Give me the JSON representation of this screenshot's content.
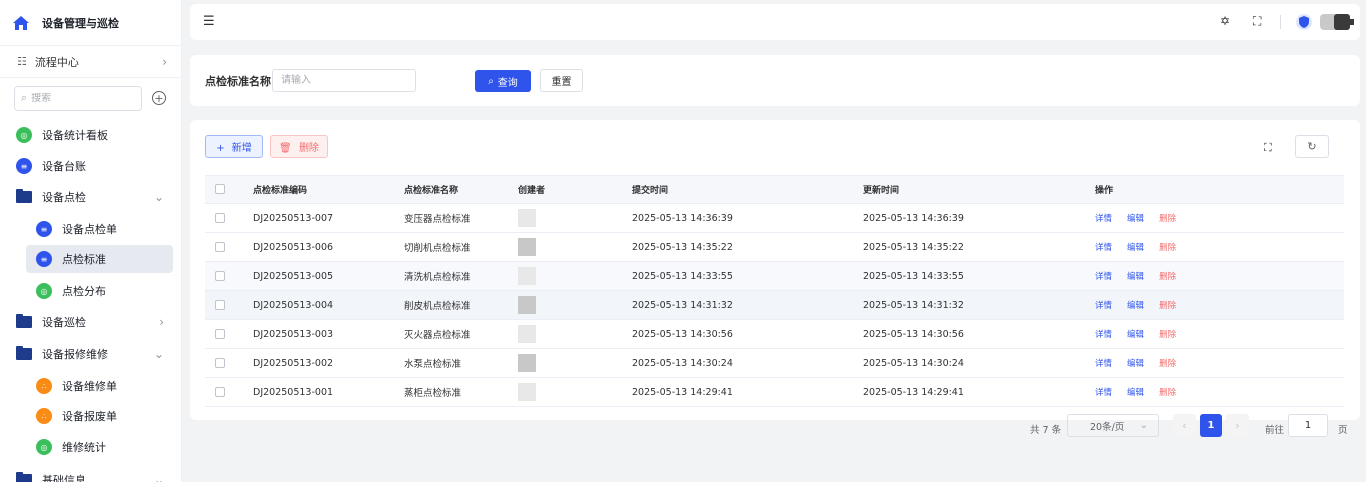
{
  "sidebar": {
    "brand": "设备管理与巡检",
    "flow_center": "流程中心",
    "search_placeholder": "搜索",
    "items": [
      {
        "label": "设备统计看板"
      },
      {
        "label": "设备台账"
      },
      {
        "label": "设备点检"
      },
      {
        "label": "设备点检单"
      },
      {
        "label": "点检标准"
      },
      {
        "label": "点检分布"
      },
      {
        "label": "设备巡检"
      },
      {
        "label": "设备报修维修"
      },
      {
        "label": "设备维修单"
      },
      {
        "label": "设备报废单"
      },
      {
        "label": "维修统计"
      },
      {
        "label": "基础信息"
      }
    ]
  },
  "search": {
    "field_label": "点检标准名称",
    "placeholder": "请输入",
    "query_label": "查询",
    "reset_label": "重置"
  },
  "toolbar": {
    "add_label": "新增",
    "delete_label": "删除"
  },
  "table": {
    "columns": [
      "点检标准编码",
      "点检标准名称",
      "创建者",
      "提交时间",
      "更新时间",
      "操作"
    ],
    "actions": {
      "detail": "详情",
      "edit": "编辑",
      "delete": "删除"
    },
    "rows": [
      {
        "code": "DJ20250513-007",
        "name": "变压器点检标准",
        "created": "2025-05-13 14:36:39",
        "updated": "2025-05-13 14:36:39"
      },
      {
        "code": "DJ20250513-006",
        "name": "切削机点检标准",
        "created": "2025-05-13 14:35:22",
        "updated": "2025-05-13 14:35:22"
      },
      {
        "code": "DJ20250513-005",
        "name": "清洗机点检标准",
        "created": "2025-05-13 14:33:55",
        "updated": "2025-05-13 14:33:55"
      },
      {
        "code": "DJ20250513-004",
        "name": "削皮机点检标准",
        "created": "2025-05-13 14:31:32",
        "updated": "2025-05-13 14:31:32"
      },
      {
        "code": "DJ20250513-003",
        "name": "灭火器点检标准",
        "created": "2025-05-13 14:30:56",
        "updated": "2025-05-13 14:30:56"
      },
      {
        "code": "DJ20250513-002",
        "name": "水泵点检标准",
        "created": "2025-05-13 14:30:24",
        "updated": "2025-05-13 14:30:24"
      },
      {
        "code": "DJ20250513-001",
        "name": "蒸柜点检标准",
        "created": "2025-05-13 14:29:41",
        "updated": "2025-05-13 14:29:41"
      }
    ]
  },
  "pagination": {
    "total": "共 7 条",
    "page_size": "20条/页",
    "current": "1",
    "goto_label": "前往",
    "goto_value": "1",
    "page_suffix": "页"
  },
  "colors": {
    "primary": "#2f54eb",
    "danger": "#f56c6c",
    "success": "#3bbf5c",
    "warning": "#fa8c16"
  }
}
